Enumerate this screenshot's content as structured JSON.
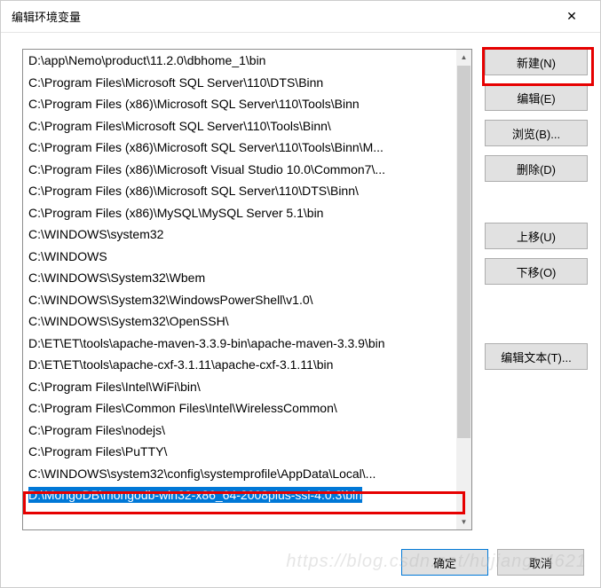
{
  "dialog": {
    "title": "编辑环境变量",
    "close_symbol": "✕"
  },
  "list": {
    "items": [
      "D:\\app\\Nemo\\product\\11.2.0\\dbhome_1\\bin",
      "C:\\Program Files\\Microsoft SQL Server\\110\\DTS\\Binn",
      "C:\\Program Files (x86)\\Microsoft SQL Server\\110\\Tools\\Binn",
      "C:\\Program Files\\Microsoft SQL Server\\110\\Tools\\Binn\\",
      "C:\\Program Files (x86)\\Microsoft SQL Server\\110\\Tools\\Binn\\M...",
      "C:\\Program Files (x86)\\Microsoft Visual Studio 10.0\\Common7\\...",
      "C:\\Program Files (x86)\\Microsoft SQL Server\\110\\DTS\\Binn\\",
      "C:\\Program Files (x86)\\MySQL\\MySQL Server 5.1\\bin",
      "C:\\WINDOWS\\system32",
      "C:\\WINDOWS",
      "C:\\WINDOWS\\System32\\Wbem",
      "C:\\WINDOWS\\System32\\WindowsPowerShell\\v1.0\\",
      "C:\\WINDOWS\\System32\\OpenSSH\\",
      "D:\\ET\\ET\\tools\\apache-maven-3.3.9-bin\\apache-maven-3.3.9\\bin",
      "D:\\ET\\ET\\tools\\apache-cxf-3.1.11\\apache-cxf-3.1.11\\bin",
      "C:\\Program Files\\Intel\\WiFi\\bin\\",
      "C:\\Program Files\\Common Files\\Intel\\WirelessCommon\\",
      "C:\\Program Files\\nodejs\\",
      "C:\\Program Files\\PuTTY\\",
      "C:\\WINDOWS\\system32\\config\\systemprofile\\AppData\\Local\\...",
      "D:\\MongoDB\\mongodb-win32-x86_64-2008plus-ssl-4.0.3\\bin"
    ],
    "selected_index": 20
  },
  "buttons": {
    "new": "新建(N)",
    "edit": "编辑(E)",
    "browse": "浏览(B)...",
    "delete": "删除(D)",
    "move_up": "上移(U)",
    "move_down": "下移(O)",
    "edit_text": "编辑文本(T)..."
  },
  "footer": {
    "ok": "确定",
    "cancel": "取消"
  },
  "watermark": "https://blog.csdn.net/hujiangu4621"
}
